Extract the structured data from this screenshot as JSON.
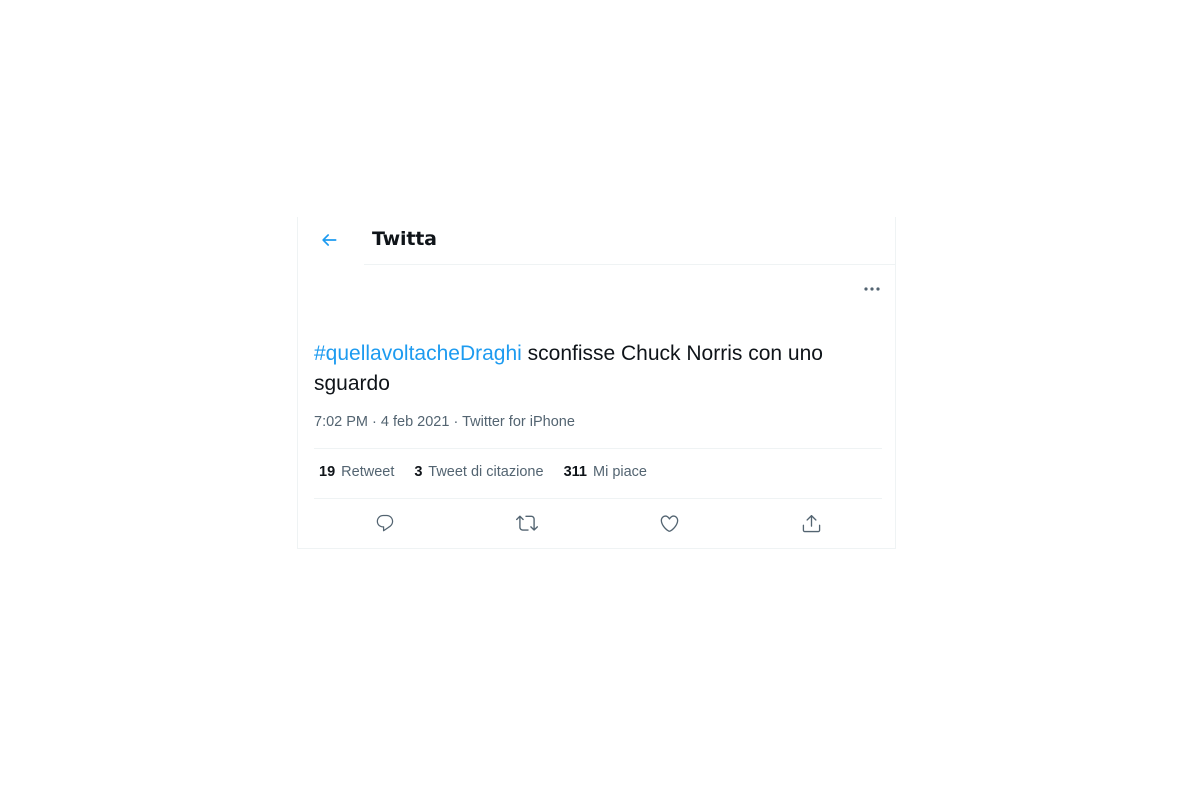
{
  "header": {
    "title": "Twitta",
    "back_icon": "arrow-left-icon",
    "accent_color": "#1d9bf0"
  },
  "tweet": {
    "hashtag": "#quellavoltacheDraghi",
    "text": " sconfisse Chuck Norris con uno sguardo",
    "time": "7:02 PM",
    "separator": " · ",
    "date": "4 feb 2021",
    "source": "Twitter for iPhone"
  },
  "stats": {
    "retweets_count": "19",
    "retweets_label": "Retweet",
    "quotes_count": "3",
    "quotes_label": "Tweet di citazione",
    "likes_count": "311",
    "likes_label": "Mi piace"
  },
  "actions": {
    "reply_icon": "reply-icon",
    "retweet_icon": "retweet-icon",
    "like_icon": "heart-icon",
    "share_icon": "share-icon",
    "more_icon": "more-icon"
  },
  "colors": {
    "text_primary": "#0f1419",
    "text_secondary": "#536471",
    "border": "#eff3f4",
    "link": "#1d9bf0"
  }
}
